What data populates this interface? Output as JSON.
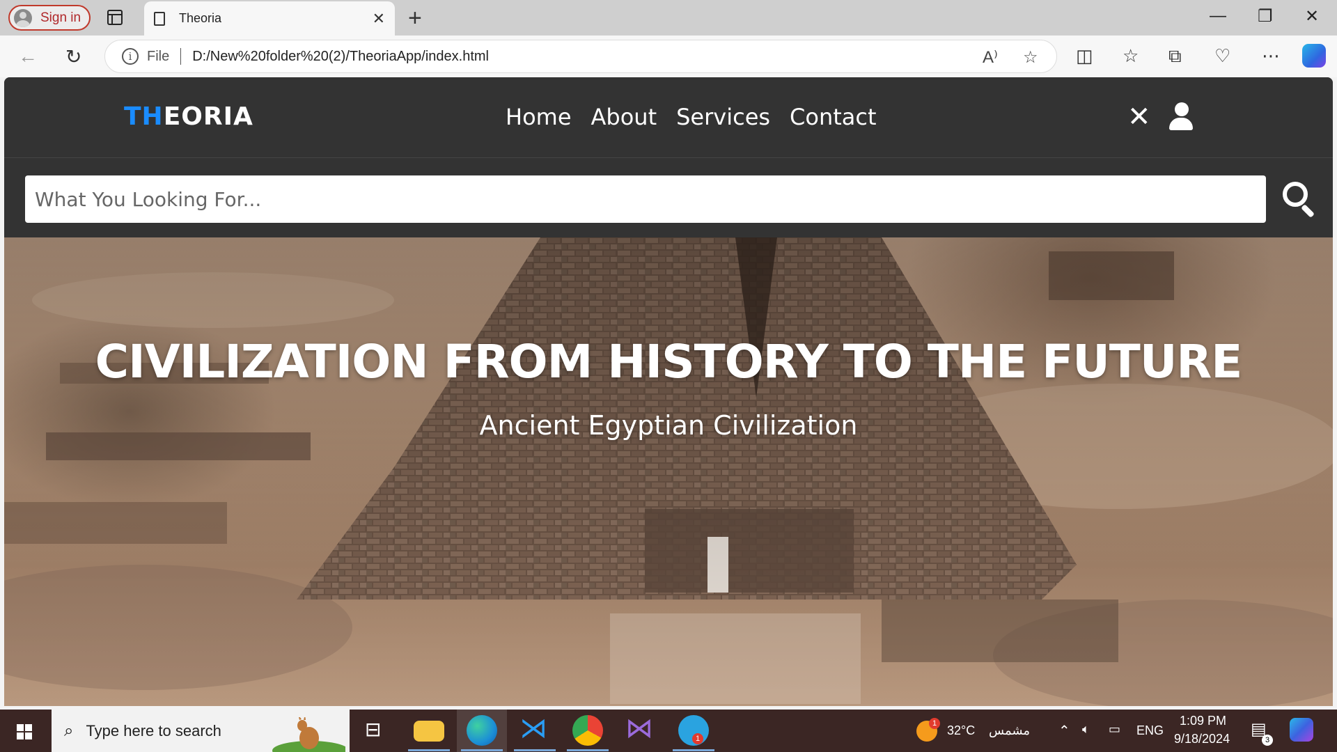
{
  "browser": {
    "signin_label": "Sign in",
    "tab_title": "Theoria",
    "address_scheme": "File",
    "address_url": "D:/New%20folder%20(2)/TheoriaApp/index.html"
  },
  "site": {
    "logo_part1": "TH",
    "logo_part2": "EORIA",
    "logo_accent_color": "#1a8cff",
    "nav_items": [
      "Home",
      "About",
      "Services",
      "Contact"
    ],
    "search_placeholder": "What You Looking For...",
    "hero_title": "CIVILIZATION FROM HISTORY TO THE FUTURE",
    "hero_subtitle": "Ancient Egyptian Civilization"
  },
  "taskbar": {
    "search_placeholder": "Type here to search",
    "weather_temp": "32°C",
    "weather_label": "مشمس",
    "weather_badge": "1",
    "language": "ENG",
    "time": "1:09 PM",
    "date": "9/18/2024",
    "telegram_badge": "1",
    "notifications_count": "3"
  }
}
